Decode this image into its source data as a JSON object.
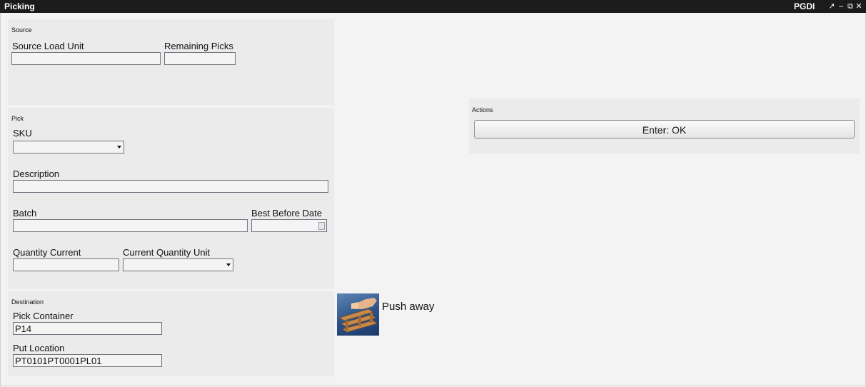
{
  "window": {
    "title": "Picking",
    "context": "PGDI",
    "pin_glyph": "↗",
    "minimize_glyph": "–",
    "restore_glyph": "⧉",
    "close_glyph": "✕"
  },
  "source": {
    "title": "Source",
    "load_unit_label": "Source Load Unit",
    "load_unit_value": "",
    "remaining_picks_label": "Remaining Picks",
    "remaining_picks_value": ""
  },
  "pick": {
    "title": "Pick",
    "sku_label": "SKU",
    "sku_value": "",
    "description_label": "Description",
    "description_value": "",
    "batch_label": "Batch",
    "batch_value": "",
    "best_before_label": "Best Before Date",
    "best_before_value": "",
    "qty_current_label": "Quantity Current",
    "qty_current_value": "",
    "qty_unit_label": "Current Quantity Unit",
    "qty_unit_value": ""
  },
  "destination": {
    "title": "Destination",
    "pick_container_label": "Pick Container",
    "pick_container_value": "P14",
    "put_location_label": "Put Location",
    "put_location_value": "PT0101PT0001PL01"
  },
  "push_away": {
    "label": "Push away",
    "icon": "pallet-push-icon"
  },
  "actions": {
    "title": "Actions",
    "ok_label": "Enter: OK"
  }
}
